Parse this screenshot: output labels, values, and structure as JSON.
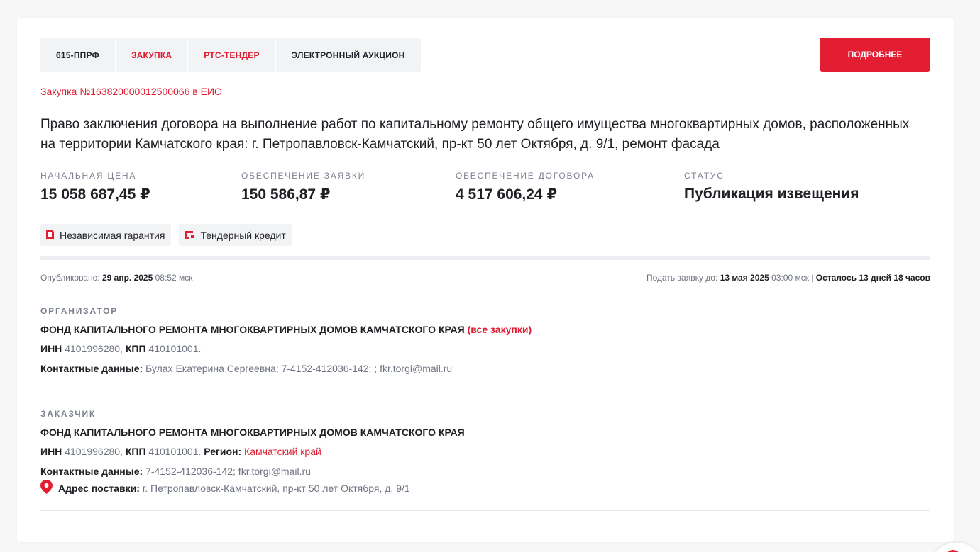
{
  "tags": [
    "615-ППРФ",
    "ЗАКУПКА",
    "РТС-ТЕНДЕР",
    "ЭЛЕКТРОННЫЙ АУКЦИОН"
  ],
  "more_button": "ПОДРОБНЕЕ",
  "eis_link": "Закупка №163820000012500066 в ЕИС",
  "title": "Право заключения договора на выполнение работ по капитальному ремонту общего имущества многоквартирных домов, расположенных на территории Камчатского края: г. Петропавловск-Камчатский, пр-кт 50 лет Октября, д. 9/1, ремонт фасада",
  "stats": {
    "initial_price": {
      "label": "НАЧАЛЬНАЯ ЦЕНА",
      "value": "15 058 687,45 ₽"
    },
    "bid_security": {
      "label": "ОБЕСПЕЧЕНИЕ ЗАЯВКИ",
      "value": "150 586,87 ₽"
    },
    "contract_security": {
      "label": "ОБЕСПЕЧЕНИЕ ДОГОВОРА",
      "value": "4 517 606,24 ₽"
    },
    "status": {
      "label": "СТАТУС",
      "value": "Публикация извещения"
    }
  },
  "chips": {
    "guarantee": "Независимая гарантия",
    "credit": "Тендерный кредит"
  },
  "colors": {
    "accent": "#e41e32",
    "chip_bg": "#f2f3f5",
    "muted": "#6f7482"
  },
  "published": {
    "label": "Опубликовано:",
    "date": "29 апр. 2025",
    "time": "08:52 мск"
  },
  "deadline": {
    "label": "Подать заявку до:",
    "date": "13 мая 2025",
    "time": "03:00 мск",
    "separator": "|",
    "remaining": "Осталось 13 дней 18 часов"
  },
  "organizer": {
    "section_label": "ОРГАНИЗАТОР",
    "name": "ФОНД КАПИТАЛЬНОГО РЕМОНТА МНОГОКВАРТИРНЫХ ДОМОВ КАМЧАТСКОГО КРАЯ",
    "all_link": "(все закупки)",
    "inn_label": "ИНН",
    "inn": "4101996280,",
    "kpp_label": "КПП",
    "kpp": "410101001.",
    "contacts_label": "Контактные данные:",
    "contacts": "Булах Екатерина Сергеевна; 7-4152-412036-142; ; fkr.torgi@mail.ru"
  },
  "customer": {
    "section_label": "ЗАКАЗЧИК",
    "name": "ФОНД КАПИТАЛЬНОГО РЕМОНТА МНОГОКВАРТИРНЫХ ДОМОВ КАМЧАТСКОГО КРАЯ",
    "inn_label": "ИНН",
    "inn": "4101996280,",
    "kpp_label": "КПП",
    "kpp": "410101001.",
    "region_label": "Регион:",
    "region": "Камчатский край",
    "contacts_label": "Контактные данные:",
    "contacts": "7-4152-412036-142; fkr.torgi@mail.ru",
    "address_label": "Адрес поставки:",
    "address": "г. Петропавловск-Камчатский, пр-кт 50 лет Октября, д. 9/1"
  }
}
